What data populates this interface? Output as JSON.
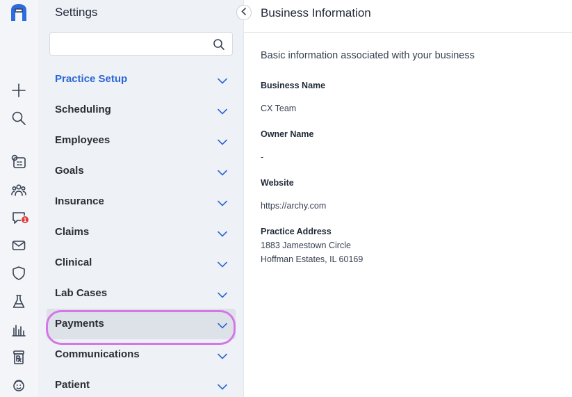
{
  "rail": {
    "icons": [
      "archy-logo-icon",
      "plus-icon",
      "search-icon",
      "schedule-icon",
      "patients-icon",
      "chat-icon",
      "mail-icon",
      "shield-icon",
      "flask-icon",
      "reports-icon",
      "prescription-icon",
      "support-icon"
    ],
    "chat_badge": "1"
  },
  "settings": {
    "title": "Settings",
    "search": {
      "value": "",
      "placeholder": ""
    },
    "items": [
      {
        "label": "Practice Setup"
      },
      {
        "label": "Scheduling"
      },
      {
        "label": "Employees"
      },
      {
        "label": "Goals"
      },
      {
        "label": "Insurance"
      },
      {
        "label": "Claims"
      },
      {
        "label": "Clinical"
      },
      {
        "label": "Lab Cases"
      },
      {
        "label": "Payments"
      },
      {
        "label": "Communications"
      },
      {
        "label": "Patient"
      }
    ]
  },
  "main": {
    "title": "Business Information",
    "subtitle": "Basic information associated with your business",
    "fields": {
      "business_name": {
        "label": "Business Name",
        "value": "CX Team"
      },
      "owner_name": {
        "label": "Owner Name",
        "value": "-"
      },
      "website": {
        "label": "Website",
        "value": "https://archy.com"
      },
      "practice_address": {
        "label": "Practice Address",
        "line1": "1883 Jamestown Circle",
        "line2": "Hoffman Estates, IL 60169"
      }
    }
  },
  "colors": {
    "accent": "#2a66d8",
    "highlight_outline": "#d676e6",
    "badge": "#e23b3b"
  }
}
